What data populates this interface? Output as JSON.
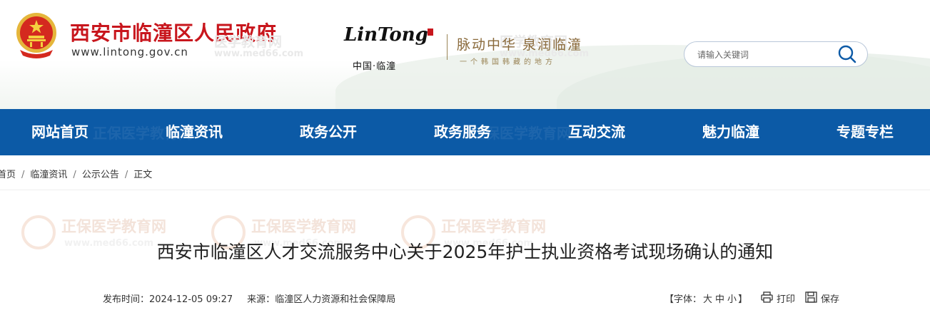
{
  "header": {
    "site_title": "西安市临潼区人民政府",
    "site_url": "www.lintong.gov.cn",
    "brand_name": "LinTong",
    "brand_sub": "中国·临潼",
    "slogan": "脉动中华 泉润临潼",
    "slogan_sub": "一个韩国韩藏的地方",
    "watermark": "医学教育网",
    "watermark_url": "www.med66.com"
  },
  "search": {
    "placeholder": "请输入关键词"
  },
  "nav": {
    "items": [
      "网站首页",
      "临潼资讯",
      "政务公开",
      "政务服务",
      "互动交流",
      "魅力临潼",
      "专题专栏"
    ],
    "watermark": "正保医学教育网"
  },
  "breadcrumb": {
    "items": [
      "首页",
      "临潼资讯",
      "公示公告",
      "正文"
    ],
    "separator": "/"
  },
  "article": {
    "watermark_brand": "正保",
    "watermark_name": "医学教育网",
    "watermark_url": "www.med66.com",
    "title": "西安市临潼区人才交流服务中心关于2025年护士执业资格考试现场确认的通知",
    "publish_label": "发布时间：",
    "publish_time": "2024-12-05 09:27",
    "source_label": "来源：",
    "source": "临潼区人力资源和社会保障局"
  },
  "tools": {
    "font_label": "【字体：",
    "font_large": "大",
    "font_medium": "中",
    "font_small": "小",
    "font_end": "】",
    "print": "打印",
    "save": "保存"
  },
  "colors": {
    "nav_bg": "#0c5aa6",
    "title_red": "#c8161d",
    "search_border": "#b9c7d9",
    "search_icon": "#0c5aa6"
  }
}
